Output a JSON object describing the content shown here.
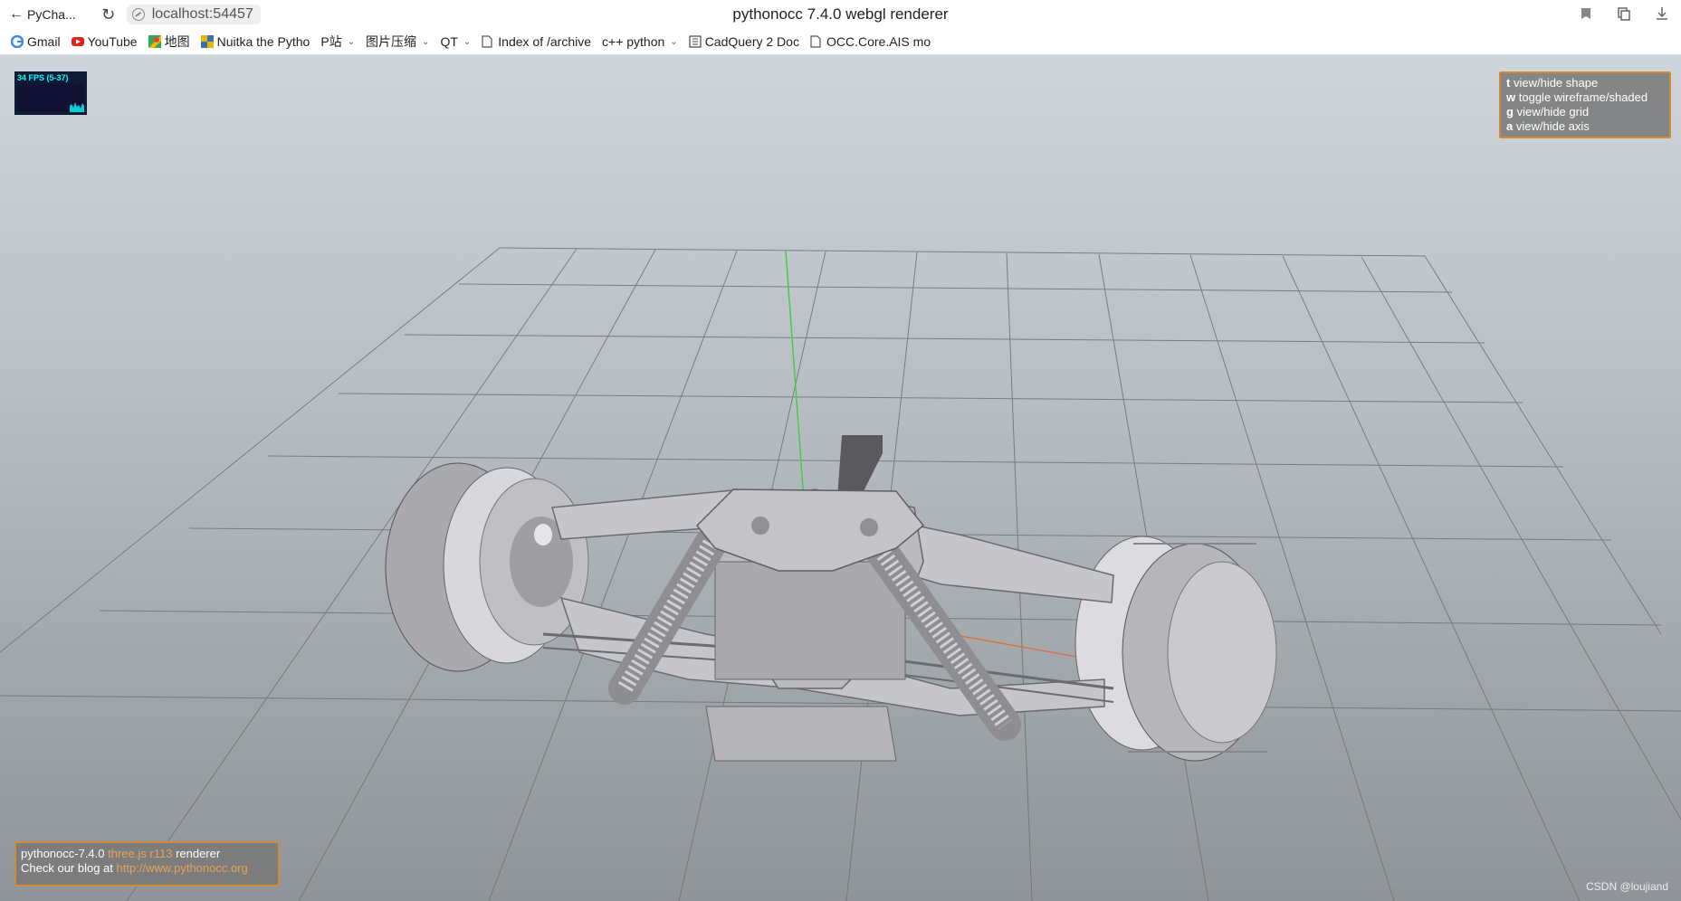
{
  "browser": {
    "back_label": "PyCha...",
    "url": "localhost:54457",
    "page_title": "pythonocc 7.4.0 webgl renderer"
  },
  "bookmarks": [
    {
      "label": "Gmail",
      "icon": "google-icon",
      "has_menu": false
    },
    {
      "label": "YouTube",
      "icon": "youtube-icon",
      "has_menu": false
    },
    {
      "label": "地图",
      "icon": "maps-icon",
      "has_menu": false
    },
    {
      "label": "Nuitka the Pytho",
      "icon": "nuitka-icon",
      "has_menu": false
    },
    {
      "label": "P站",
      "icon": "",
      "has_menu": true
    },
    {
      "label": "图片压缩",
      "icon": "",
      "has_menu": true
    },
    {
      "label": "QT",
      "icon": "",
      "has_menu": true
    },
    {
      "label": "Index of /archive",
      "icon": "page-icon",
      "has_menu": false
    },
    {
      "label": "c++ python",
      "icon": "",
      "has_menu": true
    },
    {
      "label": "CadQuery 2 Doc",
      "icon": "doc-icon",
      "has_menu": false
    },
    {
      "label": "OCC.Core.AIS mo",
      "icon": "page-icon",
      "has_menu": false
    }
  ],
  "fps": {
    "label": "34 FPS (5-37)"
  },
  "help": {
    "items": [
      {
        "key": "t",
        "text": "view/hide shape"
      },
      {
        "key": "w",
        "text": "toggle wireframe/shaded"
      },
      {
        "key": "g",
        "text": "view/hide grid"
      },
      {
        "key": "a",
        "text": "view/hide axis"
      }
    ]
  },
  "info": {
    "prefix": "pythonocc-7.4.0",
    "threejs": "three.js r113",
    "suffix": "renderer",
    "blog_prefix": "Check our blog at",
    "blog_url": "http://www.pythonocc.org"
  },
  "watermark": "CSDN @loujiand",
  "colors": {
    "accent_border": "#d08a3a",
    "link": "#e8a25a",
    "model": "#c7c7cc"
  }
}
